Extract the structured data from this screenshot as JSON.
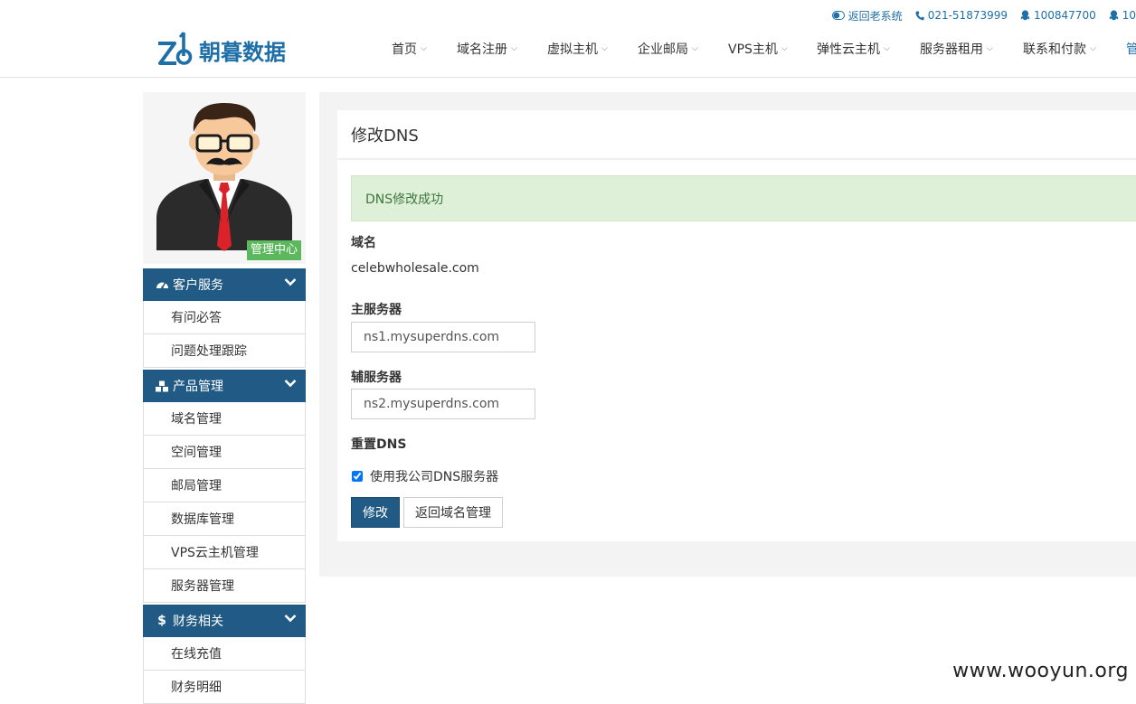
{
  "topbar": {
    "old_system": "返回老系统",
    "phone": "021-51873999",
    "qq1": "100847700",
    "qq2": "10"
  },
  "logo": {
    "text": "朝暮数据"
  },
  "nav": {
    "items": [
      "首页",
      "域名注册",
      "虚拟主机",
      "企业邮局",
      "VPS主机",
      "弹性云主机",
      "服务器租用",
      "联系和付款",
      "管"
    ]
  },
  "sidebar": {
    "admin_badge": "管理中心",
    "sections": [
      {
        "title": "客户服务",
        "icon": "dashboard-icon",
        "items": [
          "有问必答",
          "问题处理跟踪"
        ]
      },
      {
        "title": "产品管理",
        "icon": "cubes-icon",
        "items": [
          "域名管理",
          "空间管理",
          "邮局管理",
          "数据库管理",
          "VPS云主机管理",
          "服务器管理"
        ]
      },
      {
        "title": "财务相关",
        "icon": "dollar-icon",
        "items": [
          "在线充值",
          "财务明细"
        ]
      }
    ]
  },
  "main": {
    "title": "修改DNS",
    "alert": "DNS修改成功",
    "domain_label": "域名",
    "domain_value": "celebwholesale.com",
    "primary_label": "主服务器",
    "primary_value": "ns1.mysuperdns.com",
    "secondary_label": "辅服务器",
    "secondary_value": "ns2.mysuperdns.com",
    "reset_label": "重置DNS",
    "checkbox_label": "使用我公司DNS服务器",
    "checkbox_checked": true,
    "submit_label": "修改",
    "back_label": "返回域名管理"
  },
  "watermark": "www.wooyun.org",
  "colors": {
    "brand": "#215a84",
    "accent_link": "#1f6fa8",
    "success_bg": "#dff0d8",
    "badge_green": "#5cb85c"
  }
}
